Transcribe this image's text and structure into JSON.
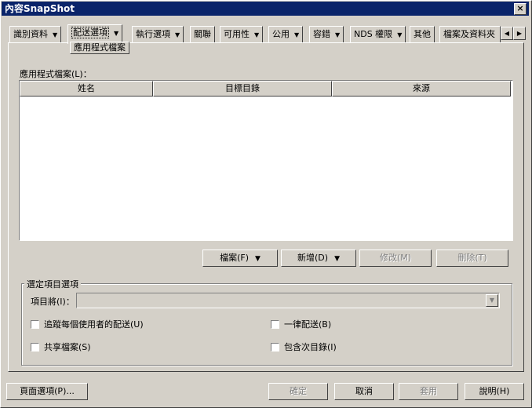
{
  "window": {
    "title": "內容SnapShot",
    "close_label": "×"
  },
  "tabs": [
    {
      "label": "識別資料",
      "has_menu": true
    },
    {
      "label": "配送選項",
      "has_menu": true
    },
    {
      "label": "執行選項",
      "has_menu": true
    },
    {
      "label": "關聯",
      "has_menu": false
    },
    {
      "label": "可用性",
      "has_menu": true
    },
    {
      "label": "公用",
      "has_menu": true
    },
    {
      "label": "容錯",
      "has_menu": true
    },
    {
      "label": "NDS 權限",
      "has_menu": true
    },
    {
      "label": "其他",
      "has_menu": false
    },
    {
      "label": "檔案及資料夾",
      "has_menu": false
    }
  ],
  "subtab": {
    "label": "應用程式檔案"
  },
  "scroll": {
    "left": "◀",
    "right": "▶"
  },
  "files_label": "應用程式檔案(L)：",
  "columns": [
    "姓名",
    "目標目錄",
    "來源"
  ],
  "list_buttons": {
    "file": "檔案(F)",
    "add": "新增(D)",
    "modify": "修改(M)",
    "delete": "刪除(T)"
  },
  "group": {
    "title": "選定項目選項",
    "item_label": "項目將(I)：",
    "item_value": "",
    "checkboxes": {
      "track": "追蹤每個使用者的配送(U)",
      "always": "一律配送(B)",
      "shared": "共享檔案(S)",
      "subdirs": "包含次目錄(I)"
    }
  },
  "footer": {
    "page_options": "頁面選項(P)...",
    "ok": "確定",
    "cancel": "取消",
    "apply": "套用",
    "help": "說明(H)"
  },
  "colors": {
    "title_bg": "#0a246a",
    "dialog_bg": "#d4d0c8"
  }
}
